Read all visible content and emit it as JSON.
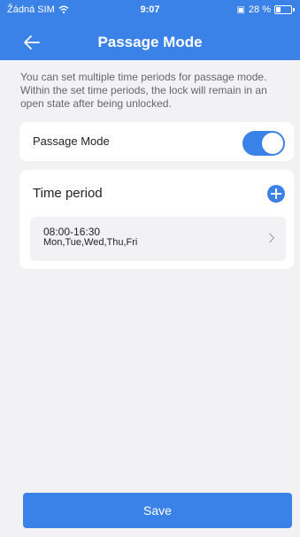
{
  "status_bar": {
    "carrier": "Žádná SIM",
    "time": "9:07",
    "battery": "28 %"
  },
  "nav": {
    "title": "Passage Mode",
    "back_icon": "arrow-left-icon"
  },
  "description": "You can set multiple time periods for passage mode. Within the set time periods, the lock will remain in an open state after being unlocked.",
  "passage_mode": {
    "label": "Passage Mode",
    "enabled": true
  },
  "time_periods": {
    "title": "Time period",
    "add_icon": "plus-circle-icon",
    "items": [
      {
        "time": "08:00-16:30",
        "days": "Mon,Tue,Wed,Thu,Fri"
      }
    ]
  },
  "save_label": "Save",
  "colors": {
    "accent": "#3b82e8",
    "background": "#f2f2f4",
    "card": "#ffffff"
  }
}
